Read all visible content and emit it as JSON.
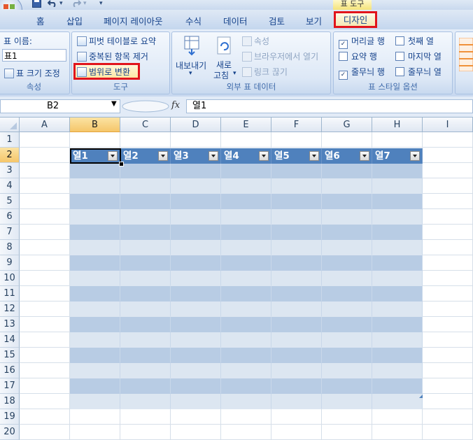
{
  "quick_access": {
    "save": "save-icon",
    "undo": "undo-icon",
    "redo": "redo-icon",
    "more": "▾"
  },
  "context_tab_label": "표 도구",
  "tabs": [
    "홈",
    "삽입",
    "페이지 레이아웃",
    "수식",
    "데이터",
    "검토",
    "보기",
    "디자인"
  ],
  "ribbon": {
    "properties": {
      "name_label": "표 이름:",
      "name_value": "표1",
      "resize_label": "표 크기 조정",
      "group_label": "속성"
    },
    "tools": {
      "pivot_label": "피벗 테이블로 요약",
      "dedupe_label": "중복된 항목 제거",
      "convert_label": "범위로 변환",
      "group_label": "도구"
    },
    "external": {
      "export_label": "내보내기",
      "refresh_line1": "새로",
      "refresh_line2": "고침",
      "properties_label": "속성",
      "open_browser_label": "브라우저에서 열기",
      "unlink_label": "링크 끊기",
      "group_label": "외부 표 데이터"
    },
    "style_options": {
      "header_row": "머리글 행",
      "total_row": "요약 행",
      "banded_rows": "줄무늬 행",
      "first_col": "첫째 열",
      "last_col": "마지막 열",
      "banded_cols": "줄무늬 열",
      "group_label": "표 스타일 옵션"
    }
  },
  "formula_bar": {
    "name_box": "B2",
    "fx": "fx",
    "value": "열1"
  },
  "grid": {
    "columns": [
      "A",
      "B",
      "C",
      "D",
      "E",
      "F",
      "G",
      "H",
      "I"
    ],
    "rows": [
      "1",
      "2",
      "3",
      "4",
      "5",
      "6",
      "7",
      "8",
      "9",
      "10",
      "11",
      "12",
      "13",
      "14",
      "15",
      "16",
      "17",
      "18",
      "19",
      "20"
    ],
    "table_headers": [
      "열1",
      "열2",
      "열3",
      "열4",
      "열5",
      "열6",
      "열7"
    ]
  },
  "colors": {
    "table_header": "#4f81bd",
    "band_dark": "#b8cce4",
    "band_light": "#dce6f1",
    "highlight": "#e1141c"
  }
}
